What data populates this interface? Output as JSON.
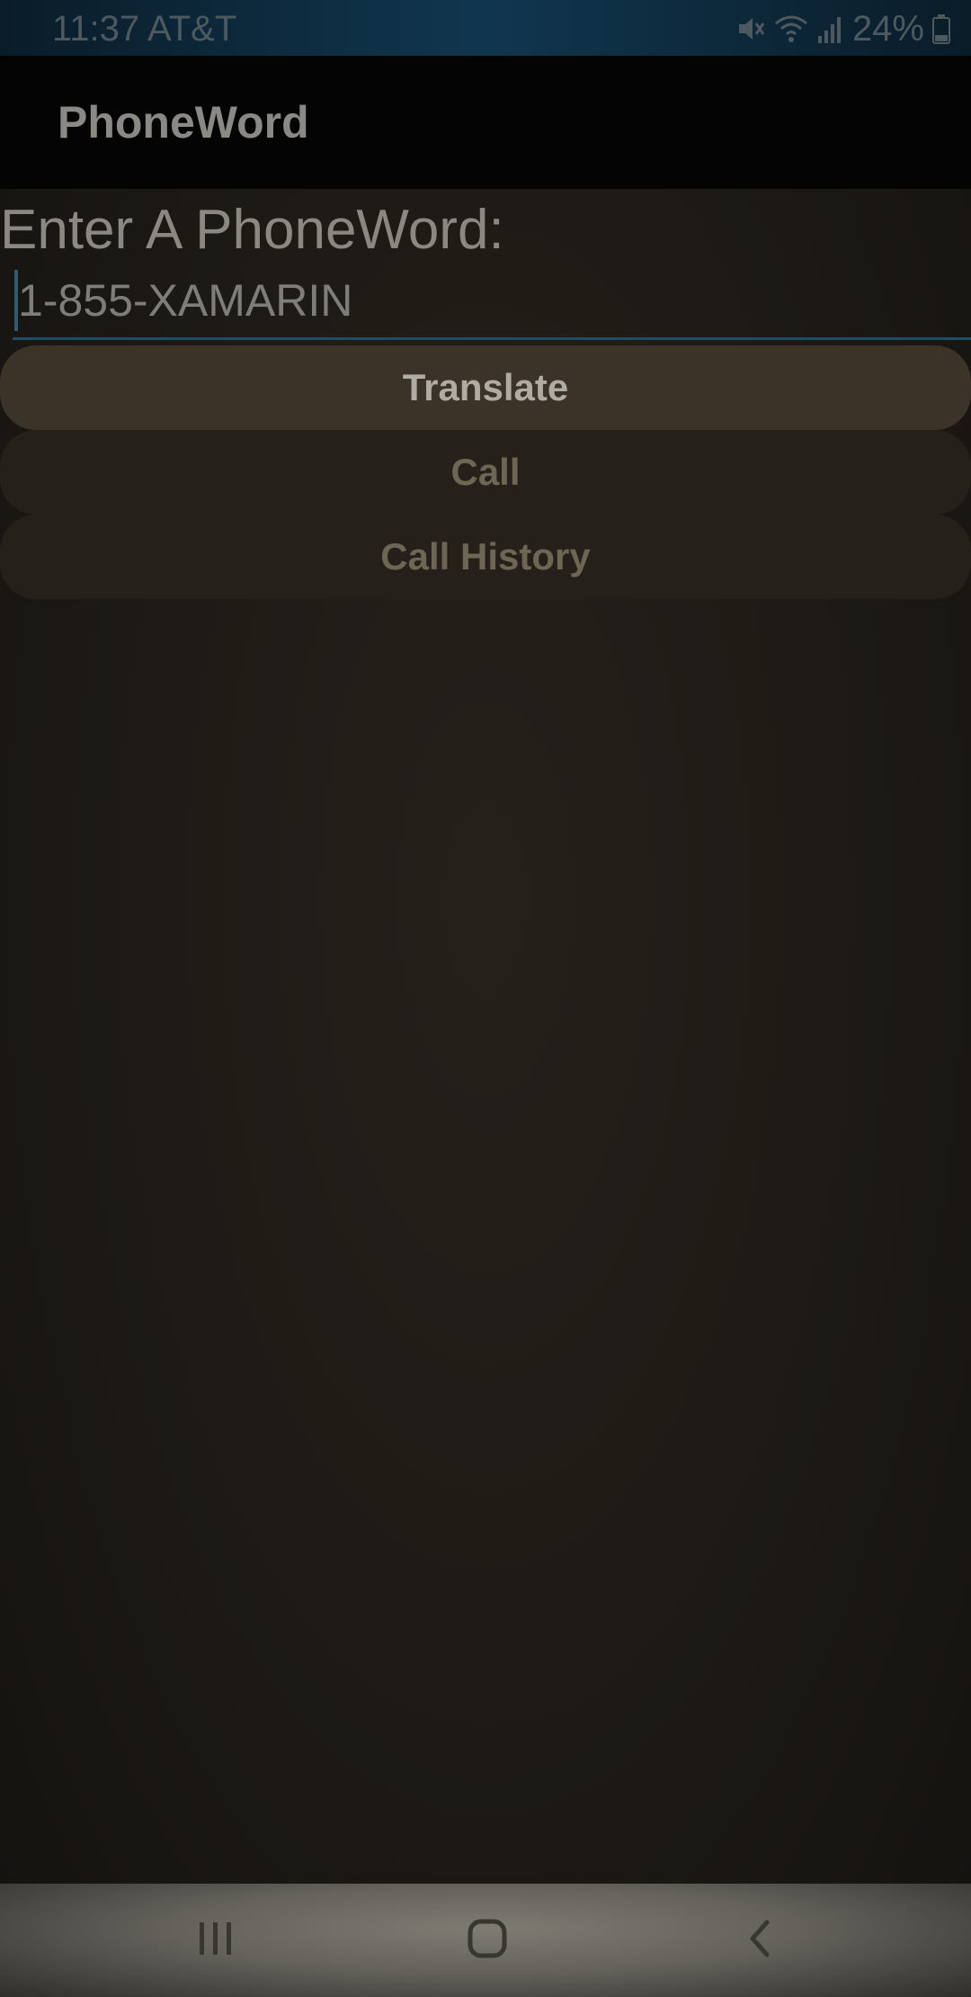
{
  "status_bar": {
    "time_carrier": "11:37 AT&T",
    "battery_percent": "24%",
    "icons": [
      "mute-icon",
      "wifi-icon",
      "signal-icon",
      "battery-icon"
    ]
  },
  "app_bar": {
    "title": "PhoneWord"
  },
  "form": {
    "prompt_label": "Enter A PhoneWord:",
    "phoneword_value": "1-855-XAMARIN"
  },
  "buttons": {
    "translate_label": "Translate",
    "call_label": "Call",
    "call_history_label": "Call History"
  },
  "nav_bar": {
    "icons": [
      "recents-icon",
      "home-icon",
      "back-icon"
    ]
  },
  "colors": {
    "background": "#1d1a15",
    "status_bar": "#10364f",
    "app_bar": "#050404",
    "translate_button": "#3b3228",
    "secondary_button": "#25201a",
    "input_underline": "#1f4e64"
  }
}
